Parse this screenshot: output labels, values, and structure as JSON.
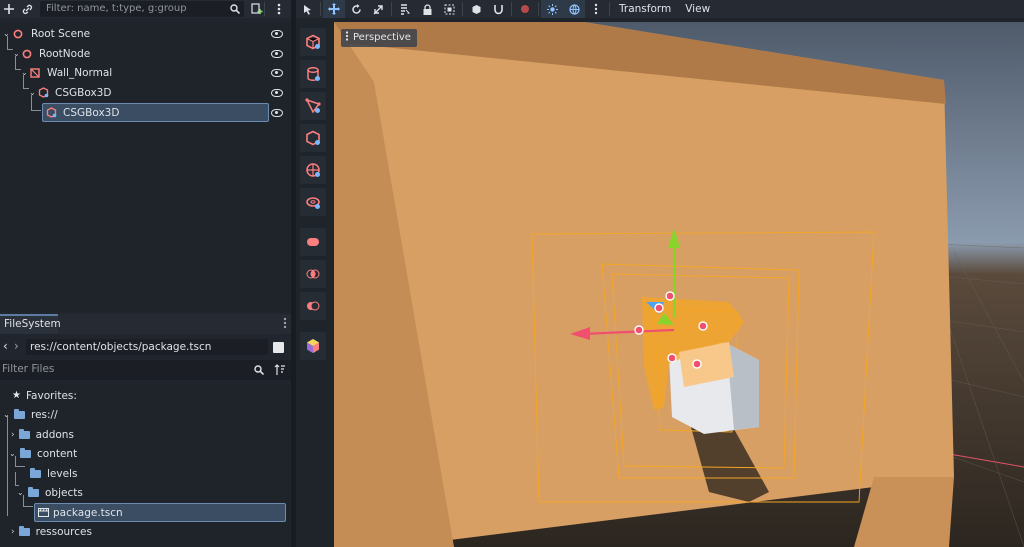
{
  "scene_dock": {
    "filter_placeholder": "Filter: name, t:type, g:group",
    "nodes": [
      {
        "label": "Root Scene",
        "icon": "node3d-icon"
      },
      {
        "label": "RootNode",
        "icon": "node3d-icon"
      },
      {
        "label": "Wall_Normal",
        "icon": "mesh-instance-icon"
      },
      {
        "label": "CSGBox3D",
        "icon": "csg-box-icon"
      },
      {
        "label": "CSGBox3D",
        "icon": "csg-box-icon"
      }
    ]
  },
  "filesystem": {
    "tab_label": "FileSystem",
    "path": "res://content/objects/package.tscn",
    "filter_placeholder": "Filter Files",
    "favorites_label": "Favorites:",
    "tree": {
      "root": "res://",
      "addons": "addons",
      "content": "content",
      "levels": "levels",
      "objects": "objects",
      "package": "package.tscn",
      "ressources": "ressources"
    }
  },
  "viewport": {
    "menus": [
      "Transform",
      "View"
    ],
    "perspective_label": "Perspective"
  },
  "colors": {
    "accent": "#5c7ca3",
    "node_red": "#fc7f7f",
    "wall": "#d79f64",
    "gizmo_orange": "#f5a623",
    "axis_y": "#88d42a",
    "axis_x": "#f0506e",
    "axis_z": "#4fa3f0"
  }
}
